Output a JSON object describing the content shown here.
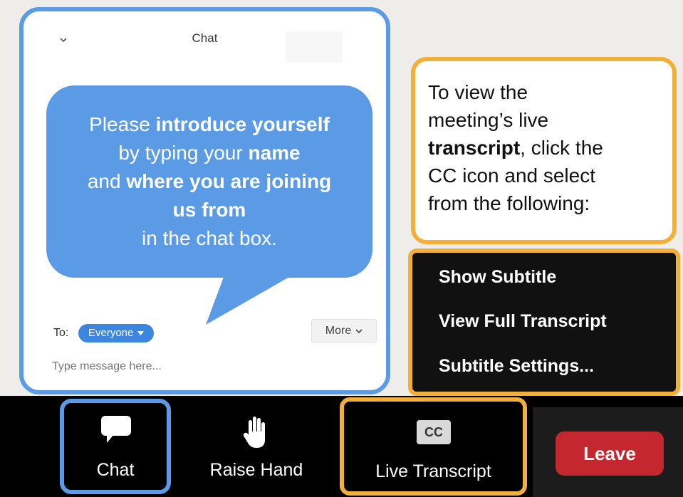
{
  "chat": {
    "title": "Chat",
    "bubble_lines": [
      [
        {
          "t": "Please ",
          "b": false
        },
        {
          "t": "introduce yourself",
          "b": true
        }
      ],
      [
        {
          "t": "by typing your ",
          "b": false
        },
        {
          "t": "name",
          "b": true
        }
      ],
      [
        {
          "t": "and ",
          "b": false
        },
        {
          "t": "where you are joining",
          "b": true
        }
      ],
      [
        {
          "t": "us from",
          "b": true
        }
      ],
      [
        {
          "t": "in the chat box.",
          "b": false
        }
      ]
    ],
    "to_label": "To:",
    "recipient": "Everyone",
    "more_label": "More",
    "input_placeholder": "Type message here..."
  },
  "instruction": {
    "parts": [
      {
        "t": "To view the",
        "b": false,
        "br": true
      },
      {
        "t": "meeting’s live",
        "b": false,
        "br": true
      },
      {
        "t": "transcript",
        "b": true,
        "br": false
      },
      {
        "t": ", click the",
        "b": false,
        "br": true
      },
      {
        "t": "CC icon and select",
        "b": false,
        "br": true
      },
      {
        "t": "from the following:",
        "b": false,
        "br": false
      }
    ]
  },
  "cc_menu": {
    "items": [
      "Show Subtitle",
      "View Full Transcript",
      "Subtitle Settings..."
    ]
  },
  "toolbar": {
    "chat_label": "Chat",
    "raise_hand_label": "Raise Hand",
    "cc_badge": "CC",
    "live_transcript_label": "Live Transcript",
    "leave_label": "Leave"
  },
  "colors": {
    "chat_highlight": "#5b9be6",
    "transcript_highlight": "#f2b03a",
    "leave_red": "#c4272d"
  }
}
